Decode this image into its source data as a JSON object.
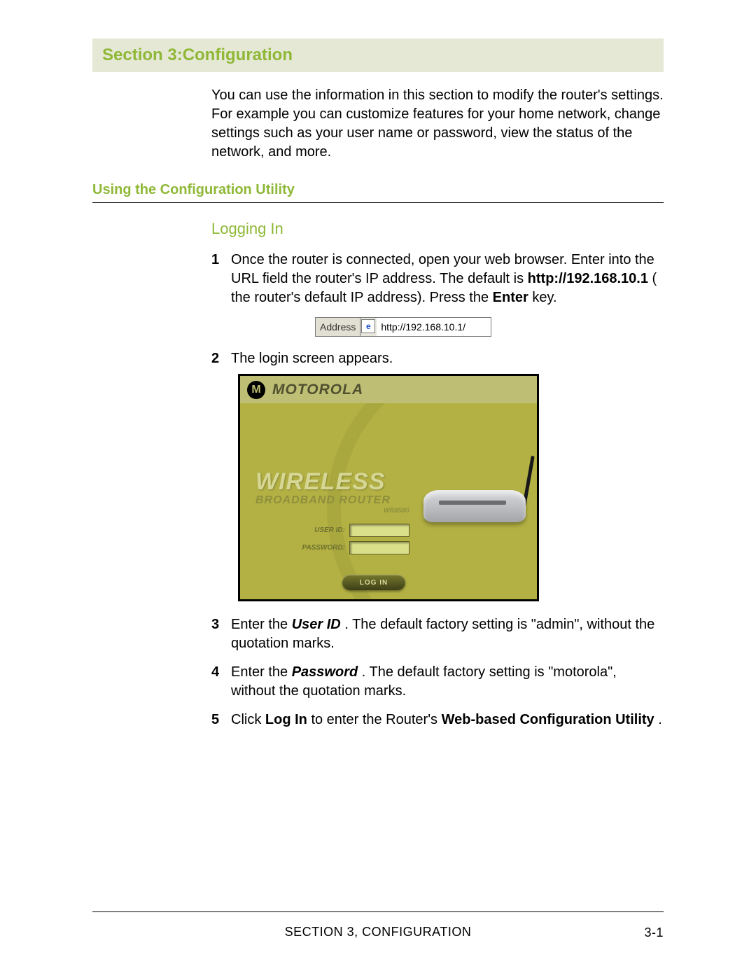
{
  "header": {
    "title": "Section 3:Configuration"
  },
  "intro": "You can use the information in this section to modify the router's settings. For example you can customize features for your home network, change settings such as your user name or password, view the status of the network, and more.",
  "h2": "Using the Configuration Utility",
  "h3": "Logging In",
  "steps": {
    "s1": {
      "pre": "Once the router is connected, open your web browser. Enter into the URL field the router's IP address.  The default is ",
      "bold_url": "http://192.168.10.1",
      "mid": " the router's default IP address). Press the ",
      "bold_enter": "Enter",
      "post": " key."
    },
    "s2": "The login screen appears.",
    "s3": {
      "pre": "Enter the ",
      "bi": "User ID",
      "post": ". The default factory setting is \"admin\", without the quotation marks."
    },
    "s4": {
      "pre": "Enter the ",
      "bi": "Password",
      "post": ". The default factory setting is \"motorola\", without the quotation marks."
    },
    "s5": {
      "pre": "Click ",
      "b1": "Log In",
      "mid": " to enter the Router's ",
      "b2": "Web-based Configuration Utility",
      "post": "."
    }
  },
  "address_bar": {
    "label": "Address",
    "icon_glyph": "e",
    "url": "http://192.168.10.1/"
  },
  "login_screenshot": {
    "brand_mark": "M",
    "brand_word": "MOTOROLA",
    "title": "WIRELESS",
    "subtitle": "BROADBAND ROUTER",
    "model": "WR850G",
    "user_label": "USER ID:",
    "password_label": "PASSWORD:",
    "login_button": "LOG IN"
  },
  "footer": {
    "center": "SECTION 3, CONFIGURATION",
    "page": "3-1"
  }
}
